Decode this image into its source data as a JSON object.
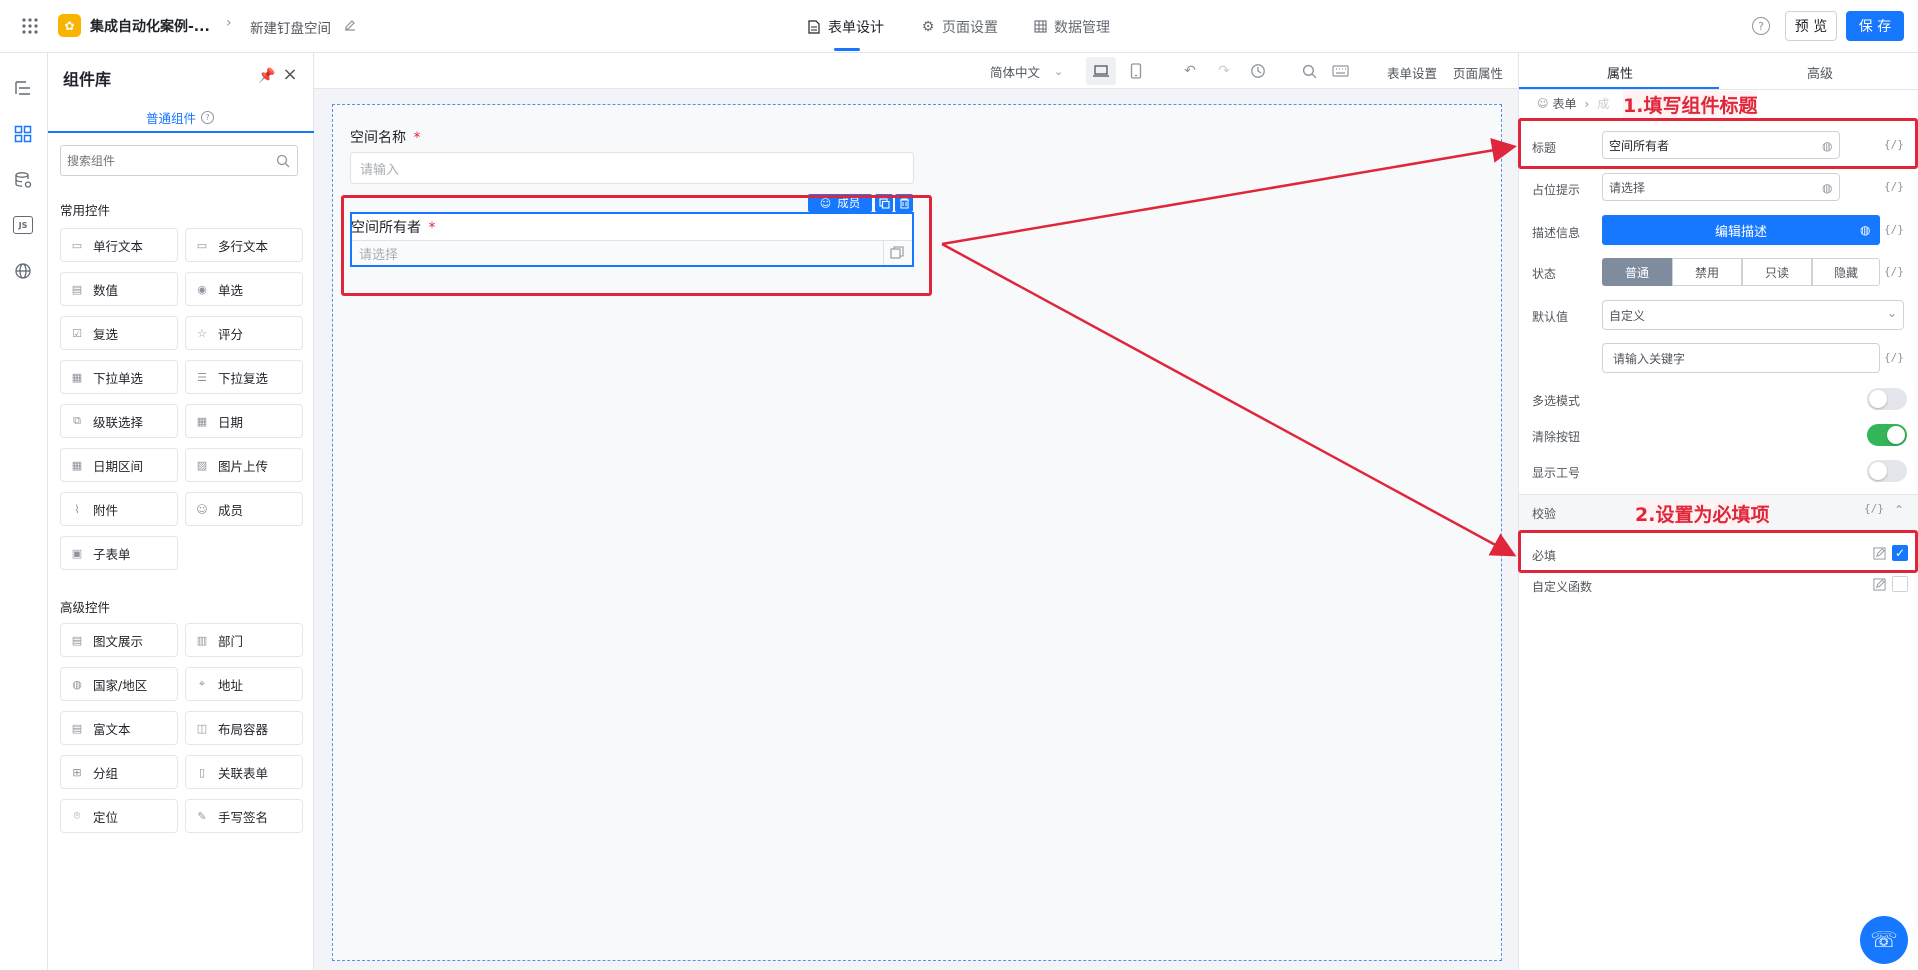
{
  "header": {
    "app_name": "集成自动化案例-...",
    "page_name": "新建钉盘空间",
    "tabs": [
      {
        "label": "表单设计",
        "active": true
      },
      {
        "label": "页面设置",
        "active": false
      },
      {
        "label": "数据管理",
        "active": false
      }
    ],
    "preview_label": "预 览",
    "save_label": "保 存"
  },
  "complib": {
    "title": "组件库",
    "tab_label": "普通组件",
    "search_placeholder": "搜索组件",
    "common_title": "常用控件",
    "common_items": [
      "单行文本",
      "多行文本",
      "数值",
      "单选",
      "复选",
      "评分",
      "下拉单选",
      "下拉复选",
      "级联选择",
      "日期",
      "日期区间",
      "图片上传",
      "附件",
      "成员",
      "子表单"
    ],
    "advanced_title": "高级控件",
    "advanced_items": [
      "图文展示",
      "部门",
      "国家/地区",
      "地址",
      "富文本",
      "布局容器",
      "分组",
      "关联表单",
      "定位",
      "手写签名"
    ]
  },
  "toolbar": {
    "language": "简体中文",
    "form_settings": "表单设置",
    "page_props": "页面属性"
  },
  "form": {
    "field1_label": "空间名称",
    "field1_placeholder": "请输入",
    "field2_label": "空间所有者",
    "field2_placeholder": "请选择",
    "field2_tag": "成员",
    "required_mark": "*"
  },
  "props": {
    "tab_props": "属性",
    "tab_advanced": "高级",
    "breadcrumb_root": "表单",
    "breadcrumb_current": "成",
    "title_label": "标题",
    "title_value": "空间所有者",
    "placeholder_label": "占位提示",
    "placeholder_value": "请选择",
    "desc_label": "描述信息",
    "desc_button": "编辑描述",
    "state_label": "状态",
    "states": [
      "普通",
      "禁用",
      "只读",
      "隐藏"
    ],
    "default_label": "默认值",
    "default_value": "自定义",
    "keyword_placeholder": "请输入关键字",
    "multi_label": "多选模式",
    "clear_label": "清除按钮",
    "jobno_label": "显示工号",
    "validate_label": "校验",
    "required_label": "必填",
    "custom_fn_label": "自定义函数",
    "fx": "{/}"
  },
  "annotations": {
    "step1": "1.填写组件标题",
    "step2": "2.设置为必填项"
  },
  "colors": {
    "primary": "#1677ff",
    "annotation_red": "#e0263a",
    "toggle_on": "#34b55a"
  }
}
